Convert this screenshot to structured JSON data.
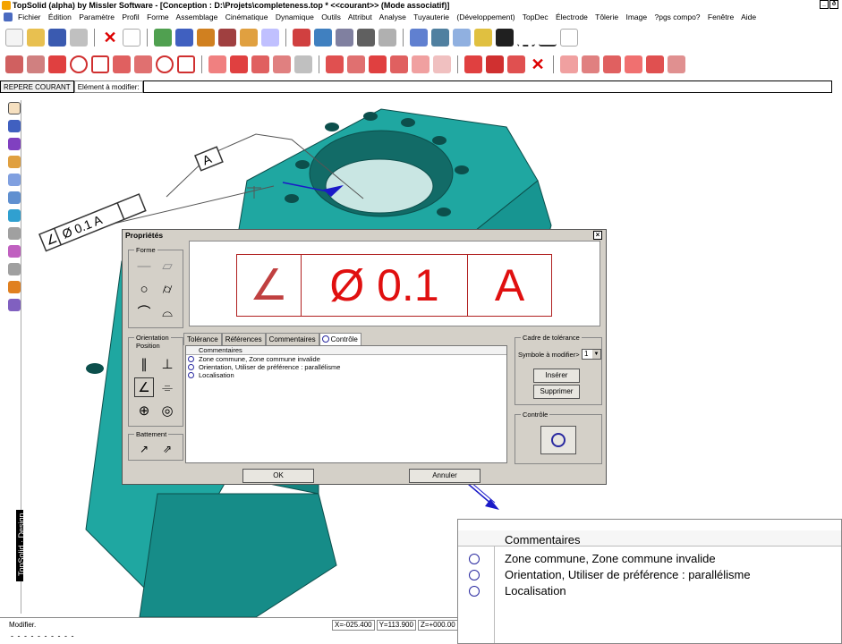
{
  "window": {
    "title": "TopSolid (alpha) by Missler Software - [Conception : D:\\Projets\\completeness.top *  <<courant>> (Mode associatif)]",
    "controls": [
      "_",
      "ð",
      "×"
    ]
  },
  "menu": {
    "items": [
      "Fichier",
      "Édition",
      "Paramètre",
      "Profil",
      "Forme",
      "Assemblage",
      "Cinématique",
      "Dynamique",
      "Outils",
      "Attribut",
      "Analyse",
      "Tuyauterie",
      "(Développement)",
      "TopDec",
      "Électrode",
      "Tôlerie",
      "Image",
      "?pgs compo?",
      "Fenêtre",
      "Aide"
    ]
  },
  "statusrow": {
    "repere_tab": "REPERE COURANT",
    "element_label": "Elément à modifier:"
  },
  "sidebar": {
    "vertical_label": "TopSolid · Design"
  },
  "annotations": {
    "datum_label": "A",
    "fcf_label": "Ø 0.1  A"
  },
  "dialog": {
    "title": "Propriétés",
    "close": "×",
    "forme_group": "Forme",
    "orientation_group": "Orientation\nPosition",
    "battement_group": "Battement",
    "preview": {
      "symbol": "∠",
      "tolerance": "Ø 0.1",
      "datum": "A"
    },
    "tabs": [
      "Tolérance",
      "Références",
      "Commentaires",
      "Contrôle"
    ],
    "comments_header": "Commentaires",
    "comments": [
      "Zone commune, Zone commune invalide",
      "Orientation, Utiliser de préférence : parallélisme",
      "Localisation"
    ],
    "cadre_group": "Cadre de tolérance",
    "symbole_label": "Symbole à modifier>",
    "symbole_value": "1",
    "inserer": "Insérer",
    "supprimer": "Supprimer",
    "controle_group": "Contrôle",
    "ok": "OK",
    "annuler": "Annuler"
  },
  "bottom": {
    "label": "Modifier.",
    "x": "X=-025.400",
    "y": "Y=113.900",
    "z": "Z=+000.00",
    "dashes": "- - - - - - - - - -"
  },
  "zoom": {
    "header": "Commentaires",
    "rows": [
      "Zone commune, Zone commune invalide",
      "Orientation, Utiliser de préférence : parallélisme",
      "Localisation"
    ]
  },
  "colors": {
    "part": "#1fa7a1",
    "part_dark": "#126b67",
    "red": "#e01010",
    "arrow": "#1a1ac8"
  }
}
